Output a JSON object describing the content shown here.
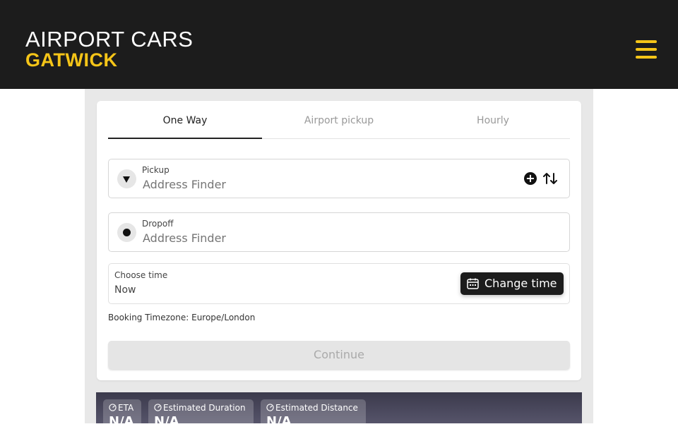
{
  "header": {
    "logo_line1": "AIRPORT CARS",
    "logo_line2": "GATWICK",
    "colors": {
      "background": "#1c1c1c",
      "accent": "#f5c518"
    }
  },
  "tabs": [
    {
      "label": "One Way",
      "active": true
    },
    {
      "label": "Airport pickup",
      "active": false
    },
    {
      "label": "Hourly",
      "active": false
    }
  ],
  "pickup": {
    "label": "Pickup",
    "placeholder": "Address Finder",
    "value": ""
  },
  "dropoff": {
    "label": "Dropoff",
    "placeholder": "Address Finder",
    "value": ""
  },
  "time": {
    "label": "Choose time",
    "value": "Now",
    "button_label": "Change time"
  },
  "timezone": {
    "label": "Booking Timezone:",
    "value": "Europe/London"
  },
  "continue_label": "Continue",
  "stats": [
    {
      "label": "ETA",
      "value": "N/A"
    },
    {
      "label": "Estimated Duration",
      "value": "N/A"
    },
    {
      "label": "Estimated Distance",
      "value": "N/A"
    }
  ],
  "icons": {
    "menu": "hamburger-menu-icon",
    "pickup": "pickup-marker-icon",
    "dropoff": "dropoff-marker-icon",
    "add_stop": "add-stop-icon",
    "swap": "swap-icon",
    "calendar": "calendar-icon",
    "gauge": "gauge-icon"
  }
}
